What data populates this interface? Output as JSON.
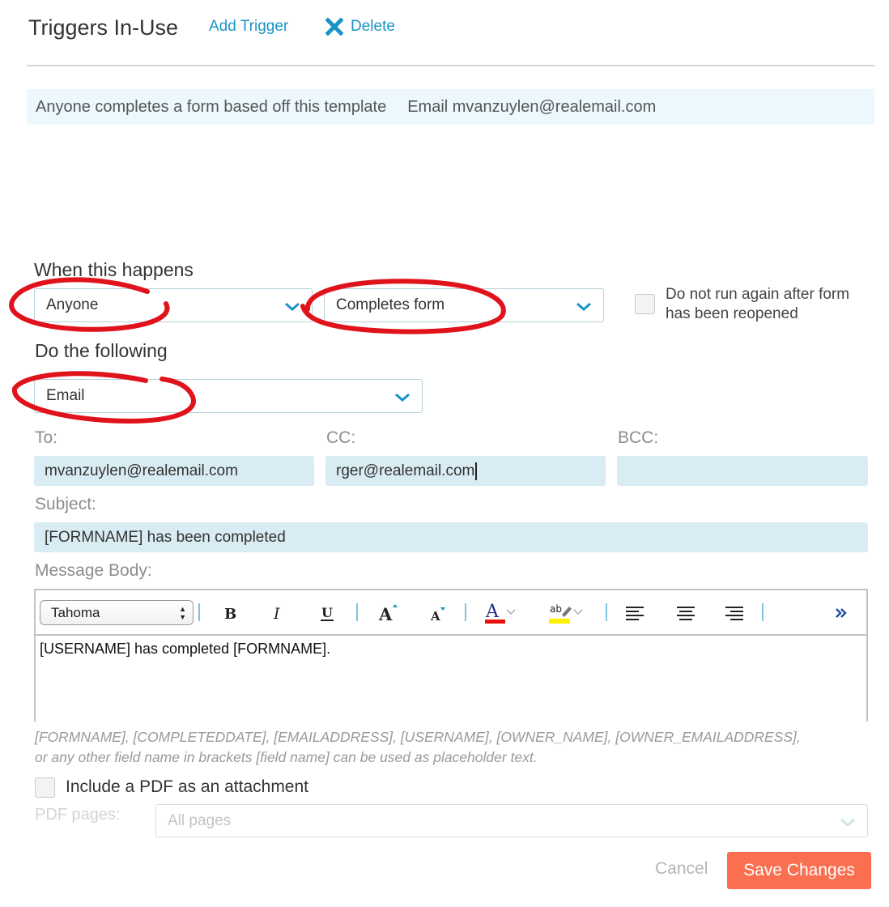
{
  "header": {
    "title": "Triggers In-Use",
    "add_trigger_label": "Add Trigger",
    "delete_label": "Delete",
    "accent_color": "#1a94c5"
  },
  "trigger_list": {
    "items": [
      {
        "condition": "Anyone completes a form based off this template",
        "action": "Email mvanzuylen@realemail.com"
      }
    ]
  },
  "when": {
    "heading": "When this happens",
    "who_value": "Anyone",
    "event_value": "Completes form",
    "no_rerun_label_line1": "Do not run again after form",
    "no_rerun_label_line2": "has been reopened",
    "no_rerun_checked": false
  },
  "do": {
    "heading": "Do the following",
    "action_value": "Email"
  },
  "email": {
    "to_label": "To:",
    "to_value": "mvanzuylen@realemail.com",
    "cc_label": "CC:",
    "cc_value": "rger@realemail.com",
    "bcc_label": "BCC:",
    "bcc_value": "",
    "subject_label": "Subject:",
    "subject_value": "[FORMNAME] has been completed",
    "body_label": "Message Body:"
  },
  "editor": {
    "font_value": "Tahoma",
    "toolbar_icons": [
      "bold-icon",
      "italic-icon",
      "underline-icon",
      "increase-font-size-icon",
      "decrease-font-size-icon",
      "font-color-icon",
      "highlight-color-icon",
      "align-left-icon",
      "align-center-icon",
      "align-right-icon",
      "more-options-icon"
    ],
    "font_color_swatch": "#e8120c",
    "highlight_swatch": "#fff200",
    "body_text": "[USERNAME] has completed [FORMNAME]."
  },
  "help": {
    "line1": "[FORMNAME], [COMPLETEDDATE], [EMAILADDRESS], [USERNAME], [OWNER_NAME], [OWNER_EMAILADDRESS],",
    "line2": "or any other field name in brackets [field name] can be used as placeholder text."
  },
  "pdf": {
    "include_label": "Include a PDF as an attachment",
    "include_checked": false,
    "pages_label": "PDF pages:",
    "pages_value": "All pages"
  },
  "footer": {
    "cancel_label": "Cancel",
    "save_label": "Save Changes",
    "save_color": "#f96f4f"
  },
  "annotations": {
    "color": "#e0121b"
  }
}
